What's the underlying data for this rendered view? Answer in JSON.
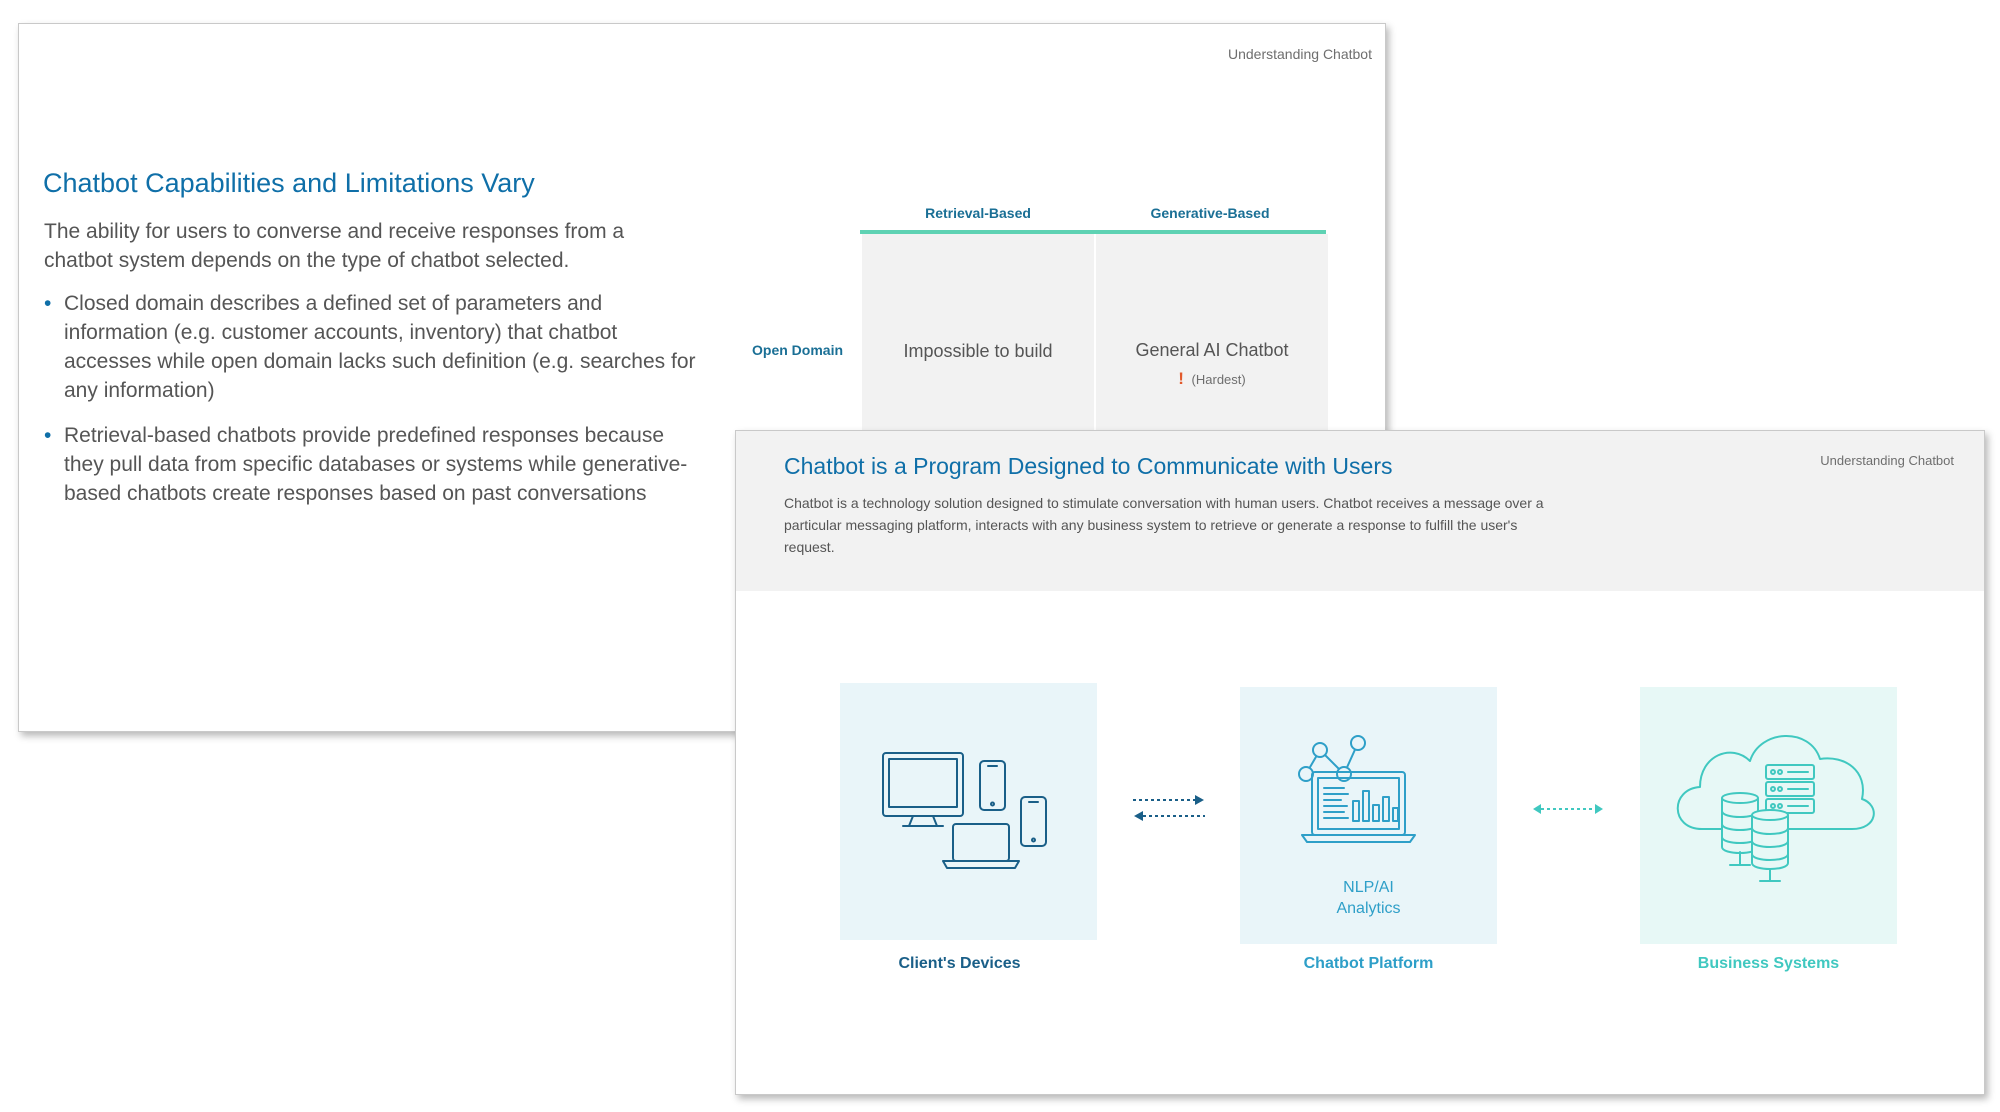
{
  "slide1": {
    "tag": "Understanding Chatbot",
    "title": "Chatbot Capabilities and Limitations Vary",
    "intro": "The ability for users to converse and receive responses from a chatbot system depends on the type of chatbot selected.",
    "bullets": [
      "Closed domain describes a defined set of parameters and information (e.g. customer accounts, inventory) that chatbot accesses while open domain lacks such definition (e.g. searches for any information)",
      "Retrieval-based chatbots provide predefined responses because they pull data from specific databases or systems while generative-based chatbots create responses based on past conversations"
    ],
    "matrix": {
      "columns": [
        "Retrieval-Based",
        "Generative-Based"
      ],
      "rows": [
        {
          "label": "Open Domain",
          "cells": [
            "Impossible to build",
            "General AI Chatbot"
          ],
          "note": "(Hardest)"
        }
      ]
    },
    "colors": {
      "title": "#0f6fa8",
      "matrix_line": "#5ed2b3",
      "warning": "#e25a2c"
    }
  },
  "slide2": {
    "tag": "Understanding Chatbot",
    "title": "Chatbot is a Program Designed to Communicate with Users",
    "description": "Chatbot is a technology solution designed to stimulate conversation with human users. Chatbot receives a message over a particular messaging platform, interacts with any business system to retrieve or generate a response to fulfill the user's request.",
    "components": [
      {
        "caption": "Client's Devices",
        "icon": "devices-icon"
      },
      {
        "caption": "Chatbot Platform",
        "icon": "analytics-laptop-icon",
        "inner_text_line1": "NLP/AI",
        "inner_text_line2": "Analytics"
      },
      {
        "caption": "Business Systems",
        "icon": "cloud-database-icon"
      }
    ],
    "colors": {
      "devices": "#1a5f88",
      "platform": "#2e9fc8",
      "systems": "#40c8c0"
    }
  }
}
